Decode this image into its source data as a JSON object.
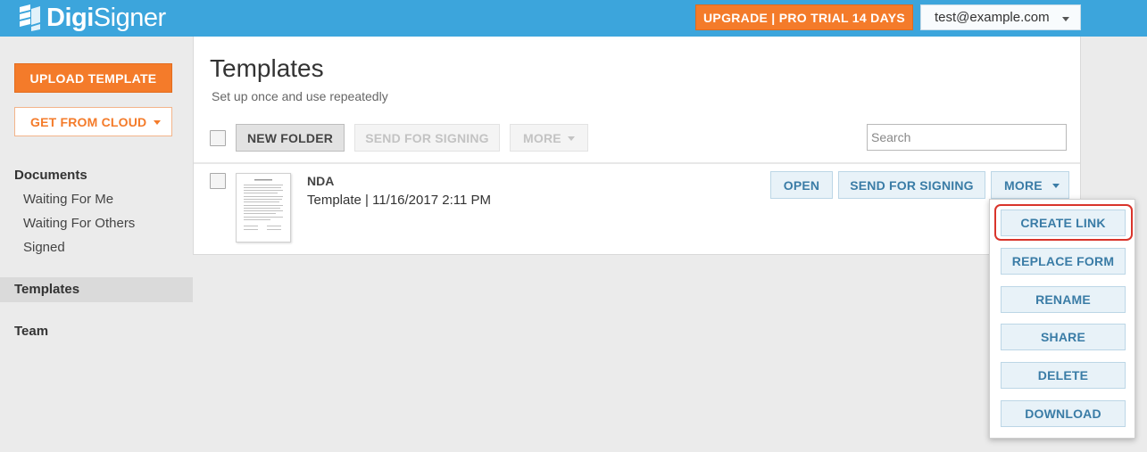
{
  "header": {
    "logo_bold": "Digi",
    "logo_light": "Signer",
    "upgrade_label": "UPGRADE | PRO TRIAL 14 DAYS",
    "user_email": "test@example.com"
  },
  "sidebar": {
    "upload_label": "UPLOAD TEMPLATE",
    "cloud_label": "GET FROM CLOUD",
    "documents_label": "Documents",
    "documents_items": [
      {
        "label": "Waiting For Me"
      },
      {
        "label": "Waiting For Others"
      },
      {
        "label": "Signed"
      }
    ],
    "templates_label": "Templates",
    "team_label": "Team"
  },
  "main": {
    "title": "Templates",
    "subtitle": "Set up once and use repeatedly",
    "toolbar": {
      "new_folder": "NEW FOLDER",
      "send_for_signing": "SEND FOR SIGNING",
      "more": "MORE",
      "search_placeholder": "Search"
    },
    "row": {
      "name": "NDA",
      "meta": "Template | 11/16/2017 2:11 PM",
      "open": "OPEN",
      "send_for_signing": "SEND FOR SIGNING",
      "more": "MORE"
    }
  },
  "dropdown": {
    "items": [
      {
        "label": "CREATE LINK"
      },
      {
        "label": "REPLACE FORM"
      },
      {
        "label": "RENAME"
      },
      {
        "label": "SHARE"
      },
      {
        "label": "DELETE"
      },
      {
        "label": "DOWNLOAD"
      }
    ]
  },
  "colors": {
    "header_bg": "#3ca5dc",
    "accent_orange": "#f47b2a",
    "button_blue_text": "#3a7ca6",
    "highlight_red": "#d9342b"
  }
}
